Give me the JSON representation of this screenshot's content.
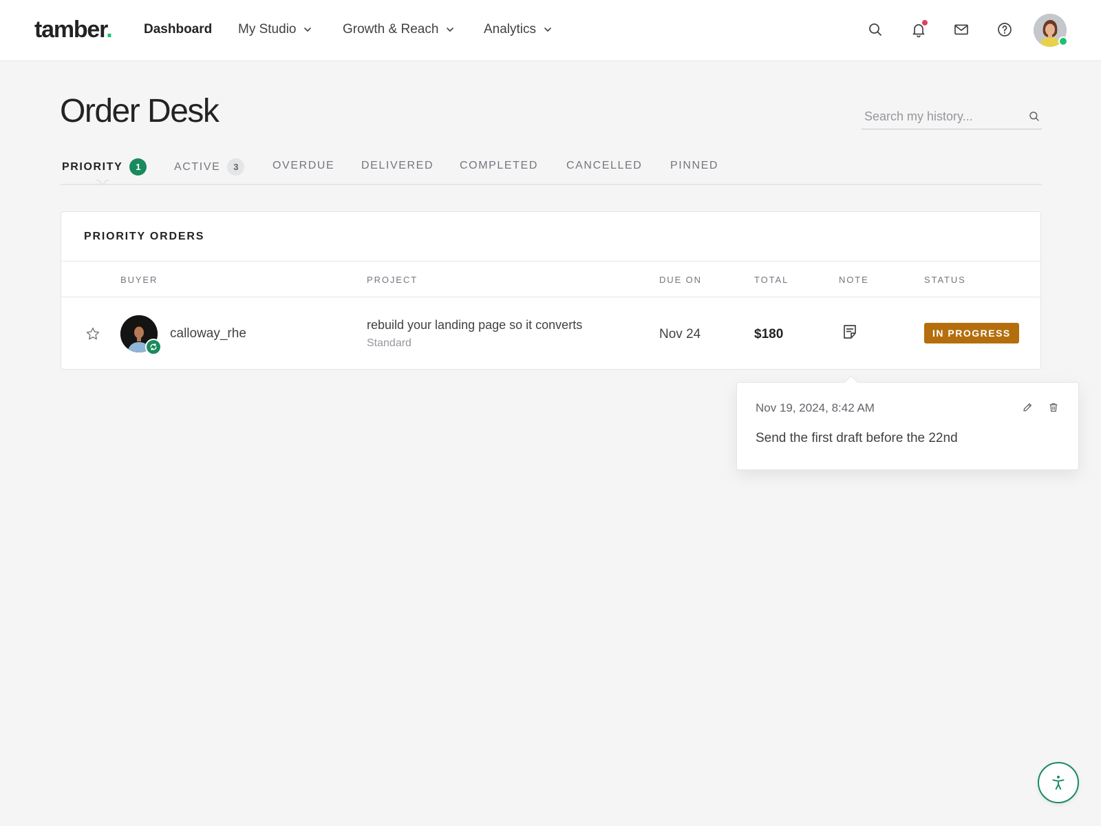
{
  "brand": {
    "name": "tamber",
    "dot": "."
  },
  "nav": {
    "items": [
      {
        "label": "Dashboard",
        "active": true
      },
      {
        "label": "My Studio",
        "dropdown": true
      },
      {
        "label": "Growth & Reach",
        "dropdown": true
      },
      {
        "label": "Analytics",
        "dropdown": true
      }
    ],
    "icons": [
      "search-icon",
      "bell-icon",
      "mail-icon",
      "help-icon"
    ],
    "has_unread_notification": true,
    "user_online": true
  },
  "page": {
    "title": "Order Desk",
    "search_placeholder": "Search my history..."
  },
  "tabs": [
    {
      "label": "PRIORITY",
      "badge": "1",
      "active": true
    },
    {
      "label": "ACTIVE",
      "badge": "3"
    },
    {
      "label": "OVERDUE"
    },
    {
      "label": "DELIVERED"
    },
    {
      "label": "COMPLETED"
    },
    {
      "label": "CANCELLED"
    },
    {
      "label": "PINNED"
    }
  ],
  "orders": {
    "title": "PRIORITY ORDERS",
    "columns": [
      "BUYER",
      "PROJECT",
      "DUE ON",
      "TOTAL",
      "NOTE",
      "STATUS"
    ],
    "rows": [
      {
        "buyer": "calloway_rhe",
        "repeat_buyer": true,
        "project": "rebuild your landing page so it converts",
        "tier": "Standard",
        "due": "Nov 24",
        "total": "$180",
        "status": "IN PROGRESS",
        "starred": false
      }
    ]
  },
  "note_popover": {
    "date": "Nov 19, 2024, 8:42 AM",
    "text": "Send the first draft before the 22nd",
    "actions": [
      "edit-icon",
      "trash-icon"
    ]
  },
  "colors": {
    "brand_accent": "#1dbf73",
    "badge_green": "#1a8a5c",
    "status_in_progress": "#b56e0d",
    "notification_dot": "#e0415f",
    "page_bg": "#f5f5f5"
  }
}
